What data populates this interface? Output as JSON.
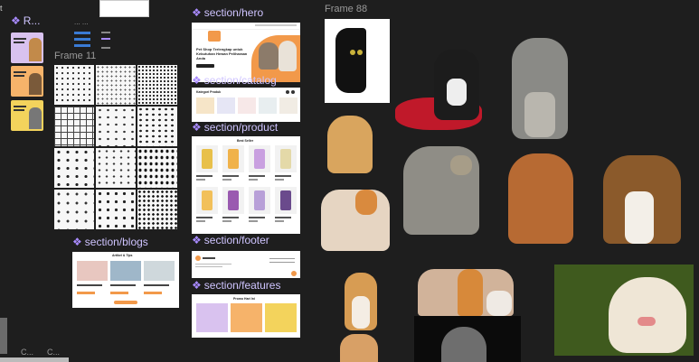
{
  "labels": {
    "r_section": "R...",
    "frame11": "Frame 11",
    "frame88": "Frame 88",
    "hero": "section/hero",
    "catalog": "section/catalog",
    "product": "section/product",
    "blogs": "section/blogs",
    "footer": "section/footer",
    "features": "section/features",
    "left_t": "t",
    "bottom_c1": "C...",
    "bottom_c2": "C...",
    "dots": "...  ..."
  },
  "hero": {
    "headline": "Pet Shop Terlengkap untuk Kebutuhan Hewan Peliharaan Anda",
    "cta": "Belanja Sekarang",
    "logo": "Beranda"
  },
  "catalog": {
    "title": "Kategori Produk"
  },
  "product": {
    "title": "Best Seller"
  },
  "blogs": {
    "title": "Artikel & Tips"
  },
  "features": {
    "title": "Promo Hari Ini"
  },
  "colors": {
    "canvas": "#1e1e1e",
    "accent_orange": "#f2994a",
    "component_purple": "#a98bff",
    "card_purple": "#d9c2ef",
    "card_orange": "#f6b36a",
    "card_yellow": "#f3d35c"
  }
}
